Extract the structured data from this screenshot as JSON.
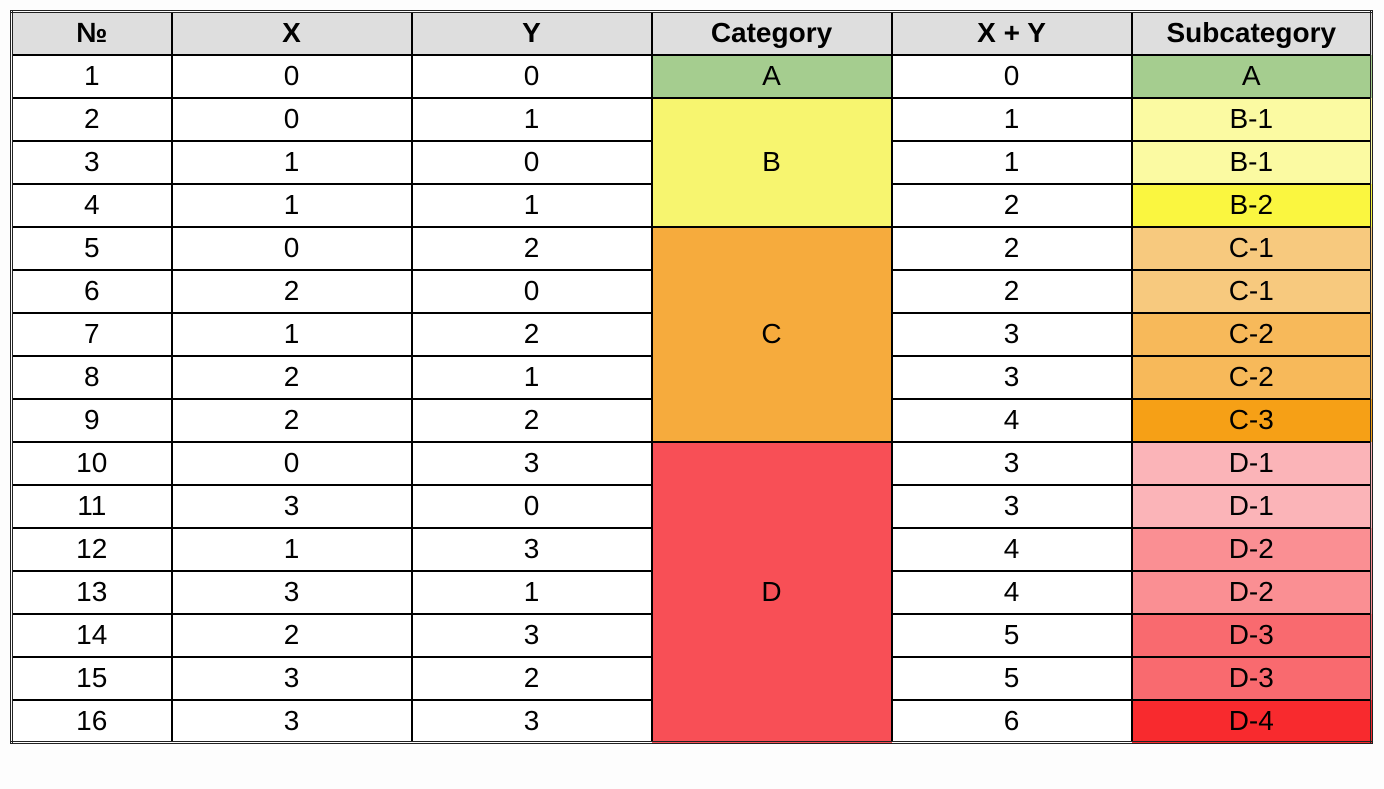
{
  "headers": {
    "num": "№",
    "x": "X",
    "y": "Y",
    "category": "Category",
    "sum": "X + Y",
    "subcategory": "Subcategory"
  },
  "colors": {
    "A": "#a5cd8f",
    "B": "#f7f56f",
    "B1": "#fbfaa2",
    "B2": "#faf640",
    "C": "#f6ab3d",
    "C1": "#f7c97e",
    "C2": "#f7b95a",
    "C3": "#f6a016",
    "D": "#f84f56",
    "D1": "#fbb4b8",
    "D2": "#fa8f93",
    "D3": "#f96a6f",
    "D4": "#f82a2e"
  },
  "categories": [
    {
      "label": "A",
      "rowspan": 1,
      "colorKey": "A"
    },
    {
      "label": "B",
      "rowspan": 3,
      "colorKey": "B"
    },
    {
      "label": "C",
      "rowspan": 5,
      "colorKey": "C"
    },
    {
      "label": "D",
      "rowspan": 7,
      "colorKey": "D"
    }
  ],
  "chart_data": {
    "type": "table",
    "columns": [
      "№",
      "X",
      "Y",
      "Category",
      "X + Y",
      "Subcategory"
    ],
    "rows": [
      {
        "num": 1,
        "x": 0,
        "y": 0,
        "category": "A",
        "sum": 0,
        "subcategory": "A",
        "subColorKey": "A"
      },
      {
        "num": 2,
        "x": 0,
        "y": 1,
        "category": "B",
        "sum": 1,
        "subcategory": "B-1",
        "subColorKey": "B1"
      },
      {
        "num": 3,
        "x": 1,
        "y": 0,
        "category": "B",
        "sum": 1,
        "subcategory": "B-1",
        "subColorKey": "B1"
      },
      {
        "num": 4,
        "x": 1,
        "y": 1,
        "category": "B",
        "sum": 2,
        "subcategory": "B-2",
        "subColorKey": "B2"
      },
      {
        "num": 5,
        "x": 0,
        "y": 2,
        "category": "C",
        "sum": 2,
        "subcategory": "C-1",
        "subColorKey": "C1"
      },
      {
        "num": 6,
        "x": 2,
        "y": 0,
        "category": "C",
        "sum": 2,
        "subcategory": "C-1",
        "subColorKey": "C1"
      },
      {
        "num": 7,
        "x": 1,
        "y": 2,
        "category": "C",
        "sum": 3,
        "subcategory": "C-2",
        "subColorKey": "C2"
      },
      {
        "num": 8,
        "x": 2,
        "y": 1,
        "category": "C",
        "sum": 3,
        "subcategory": "C-2",
        "subColorKey": "C2"
      },
      {
        "num": 9,
        "x": 2,
        "y": 2,
        "category": "C",
        "sum": 4,
        "subcategory": "C-3",
        "subColorKey": "C3"
      },
      {
        "num": 10,
        "x": 0,
        "y": 3,
        "category": "D",
        "sum": 3,
        "subcategory": "D-1",
        "subColorKey": "D1"
      },
      {
        "num": 11,
        "x": 3,
        "y": 0,
        "category": "D",
        "sum": 3,
        "subcategory": "D-1",
        "subColorKey": "D1"
      },
      {
        "num": 12,
        "x": 1,
        "y": 3,
        "category": "D",
        "sum": 4,
        "subcategory": "D-2",
        "subColorKey": "D2"
      },
      {
        "num": 13,
        "x": 3,
        "y": 1,
        "category": "D",
        "sum": 4,
        "subcategory": "D-2",
        "subColorKey": "D2"
      },
      {
        "num": 14,
        "x": 2,
        "y": 3,
        "category": "D",
        "sum": 5,
        "subcategory": "D-3",
        "subColorKey": "D3"
      },
      {
        "num": 15,
        "x": 3,
        "y": 2,
        "category": "D",
        "sum": 5,
        "subcategory": "D-3",
        "subColorKey": "D3"
      },
      {
        "num": 16,
        "x": 3,
        "y": 3,
        "category": "D",
        "sum": 6,
        "subcategory": "D-4",
        "subColorKey": "D4"
      }
    ]
  }
}
